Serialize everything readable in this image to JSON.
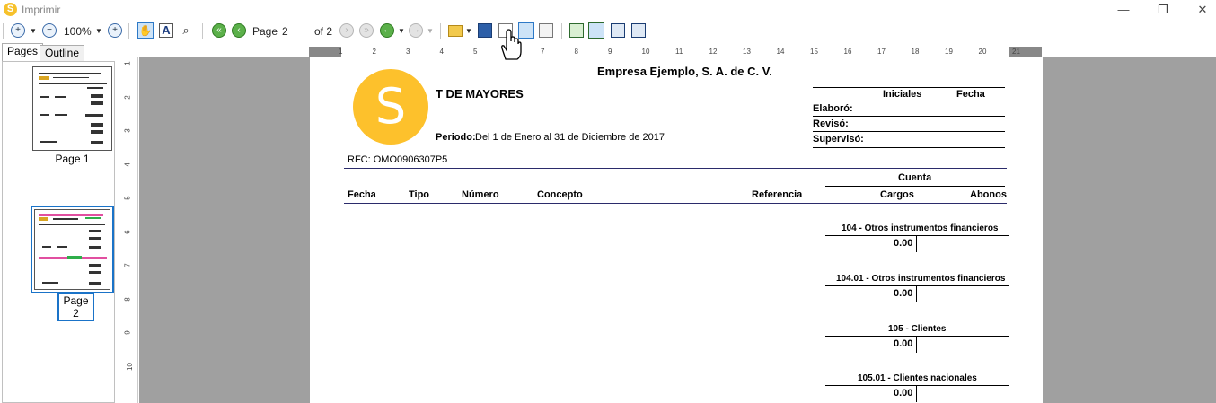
{
  "window": {
    "title": "Imprimir",
    "app_icon_letter": "S",
    "minimize": "—",
    "restore": "❐",
    "close": "✕"
  },
  "toolbar": {
    "zoom_level": "100%",
    "page_label": "Page",
    "page_value": "2",
    "of_label": "of 2"
  },
  "tabs": [
    "Pages",
    "Outline"
  ],
  "thumbnails": [
    {
      "label": "Page 1",
      "selected": false
    },
    {
      "label": "Page 2",
      "selected": true
    }
  ],
  "ruler": {
    "h_numbers": [
      "1",
      "2",
      "3",
      "4",
      "5",
      "6",
      "7",
      "8",
      "9",
      "10",
      "11",
      "12",
      "13",
      "14",
      "15",
      "16",
      "17",
      "18",
      "19",
      "20",
      "21"
    ],
    "v_numbers": [
      "1",
      "2",
      "3",
      "4",
      "5",
      "6",
      "7",
      "8",
      "9",
      "10"
    ]
  },
  "report": {
    "company": "Empresa Ejemplo, S. A. de C. V.",
    "logo_letter": "S",
    "title": "T DE MAYORES",
    "period_label": "Periodo:",
    "period_value": "Del 1 de Enero al 31 de Diciembre de 2017",
    "rfc": "RFC: OMO0906307P5",
    "sign_headers": {
      "initials": "Iniciales",
      "date": "Fecha"
    },
    "sign_rows": [
      "Elaboró:",
      "Revisó:",
      "Supervisó:"
    ],
    "columns": {
      "fecha": "Fecha",
      "tipo": "Tipo",
      "numero": "Número",
      "concepto": "Concepto",
      "referencia": "Referencia",
      "cuenta": "Cuenta",
      "cargos": "Cargos",
      "abonos": "Abonos"
    },
    "accounts": [
      {
        "name": "104 - Otros instrumentos financieros",
        "amount": "0.00"
      },
      {
        "name": "104.01 - Otros instrumentos financieros",
        "amount": "0.00"
      },
      {
        "name": "105 - Clientes",
        "amount": "0.00"
      },
      {
        "name": "105.01 - Clientes nacionales",
        "amount": "0.00"
      }
    ]
  },
  "colors": {
    "logo": "#fdc12c",
    "selection": "#1a73c8",
    "rule_blue": "#2b2b6b"
  }
}
